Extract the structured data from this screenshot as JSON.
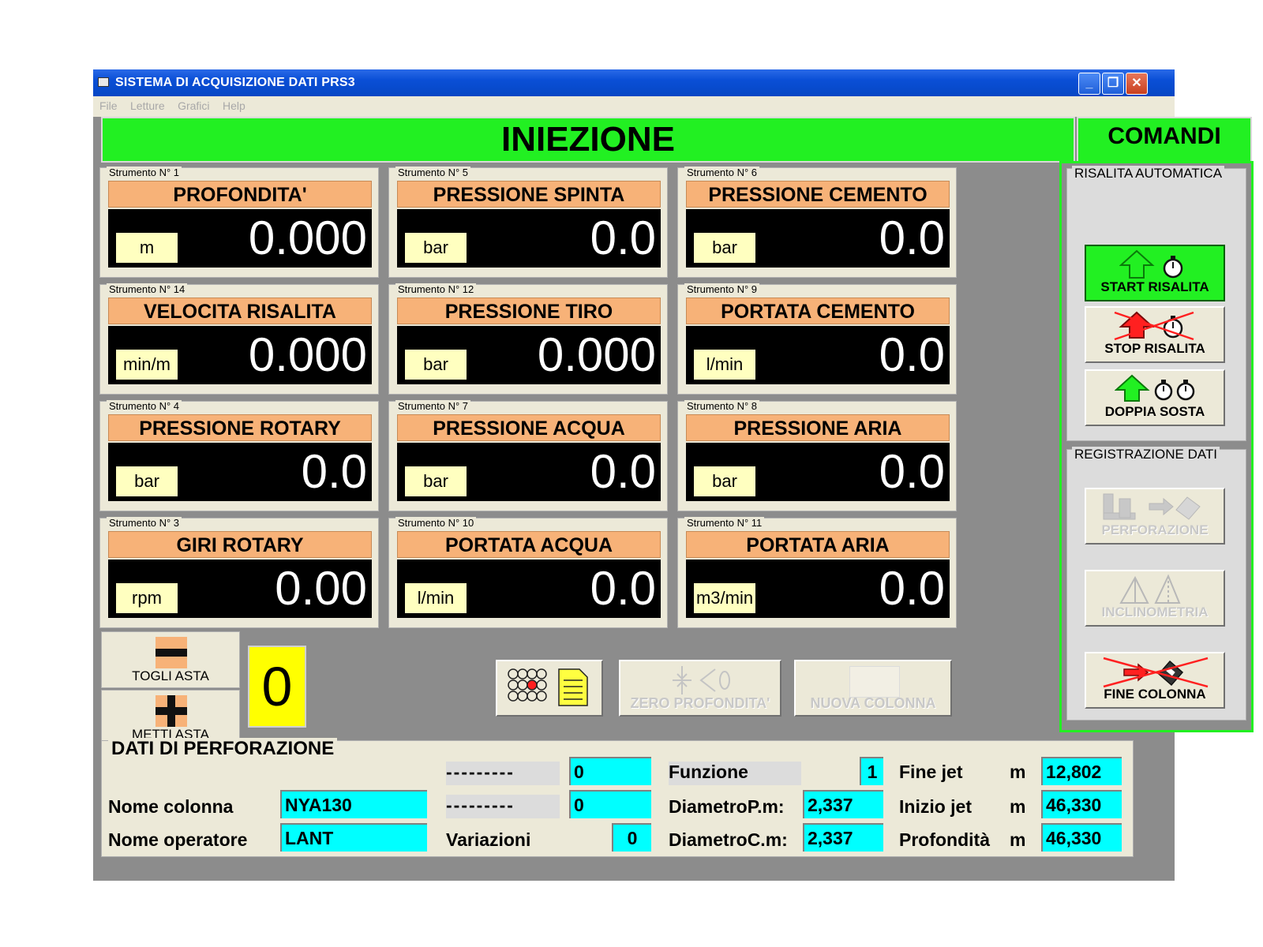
{
  "window": {
    "title": "SISTEMA DI ACQUISIZIONE DATI PRS3"
  },
  "menu": [
    "File",
    "Letture",
    "Grafici",
    "Help"
  ],
  "headers": {
    "main": "INIEZIONE",
    "side": "COMANDI"
  },
  "instruments": [
    {
      "label": "Strumento N° 1",
      "title": "PROFONDITA'",
      "unit": "m",
      "value": "0.000"
    },
    {
      "label": "Strumento N° 5",
      "title": "PRESSIONE SPINTA",
      "unit": "bar",
      "value": "0.0"
    },
    {
      "label": "Strumento N° 6",
      "title": "PRESSIONE CEMENTO",
      "unit": "bar",
      "value": "0.0"
    },
    {
      "label": "Strumento N° 14",
      "title": "VELOCITA RISALITA",
      "unit": "min/m",
      "value": "0.000"
    },
    {
      "label": "Strumento N° 12",
      "title": "PRESSIONE TIRO",
      "unit": "bar",
      "value": "0.000"
    },
    {
      "label": "Strumento N° 9",
      "title": "PORTATA CEMENTO",
      "unit": "l/min",
      "value": "0.0"
    },
    {
      "label": "Strumento N° 4",
      "title": "PRESSIONE ROTARY",
      "unit": "bar",
      "value": "0.0"
    },
    {
      "label": "Strumento N° 7",
      "title": "PRESSIONE ACQUA",
      "unit": "bar",
      "value": "0.0"
    },
    {
      "label": "Strumento N° 8",
      "title": "PRESSIONE ARIA",
      "unit": "bar",
      "value": "0.0"
    },
    {
      "label": "Strumento N° 3",
      "title": "GIRI ROTARY",
      "unit": "rpm",
      "value": "0.00"
    },
    {
      "label": "Strumento N° 10",
      "title": "PORTATA ACQUA",
      "unit": "l/min",
      "value": "0.0"
    },
    {
      "label": "Strumento N° 11",
      "title": "PORTATA ARIA",
      "unit": "m3/min",
      "value": "0.0"
    }
  ],
  "commands": {
    "risalita_group": "RISALITA AUTOMATICA",
    "start": "START RISALITA",
    "stop": "STOP RISALITA",
    "doppia": "DOPPIA SOSTA",
    "registrazione_group": "REGISTRAZIONE DATI",
    "perforazione": "PERFORAZIONE",
    "inclinometria": "INCLINOMETRIA",
    "fine": "FINE COLONNA"
  },
  "asta": {
    "togli": "TOGLI ASTA",
    "metti": "METTI ASTA",
    "counter": "0"
  },
  "buttons": {
    "zero": "ZERO PROFONDITA'",
    "nuova": "NUOVA COLONNA"
  },
  "dati": {
    "title": "DATI DI PERFORAZIONE",
    "dash1": "---------",
    "dash1_val": "0",
    "dash2": "---------",
    "dash2_val": "0",
    "nome_colonna_label": "Nome colonna",
    "nome_colonna": "NYA130",
    "nome_operatore_label": "Nome operatore",
    "nome_operatore": "LANT",
    "variazioni_label": "Variazioni",
    "variazioni": "0",
    "funzione_label": "Funzione",
    "funzione": "1",
    "diametro_p_label": "DiametroP.m:",
    "diametro_p": "2,337",
    "diametro_c_label": "DiametroC.m:",
    "diametro_c": "2,337",
    "fine_jet_label": "Fine jet",
    "fine_jet_unit": "m",
    "fine_jet": "12,802",
    "inizio_jet_label": "Inizio jet",
    "inizio_jet_unit": "m",
    "inizio_jet": "46,330",
    "profondita_label": "Profondità",
    "profondita_unit": "m",
    "profondita": "46,330"
  }
}
